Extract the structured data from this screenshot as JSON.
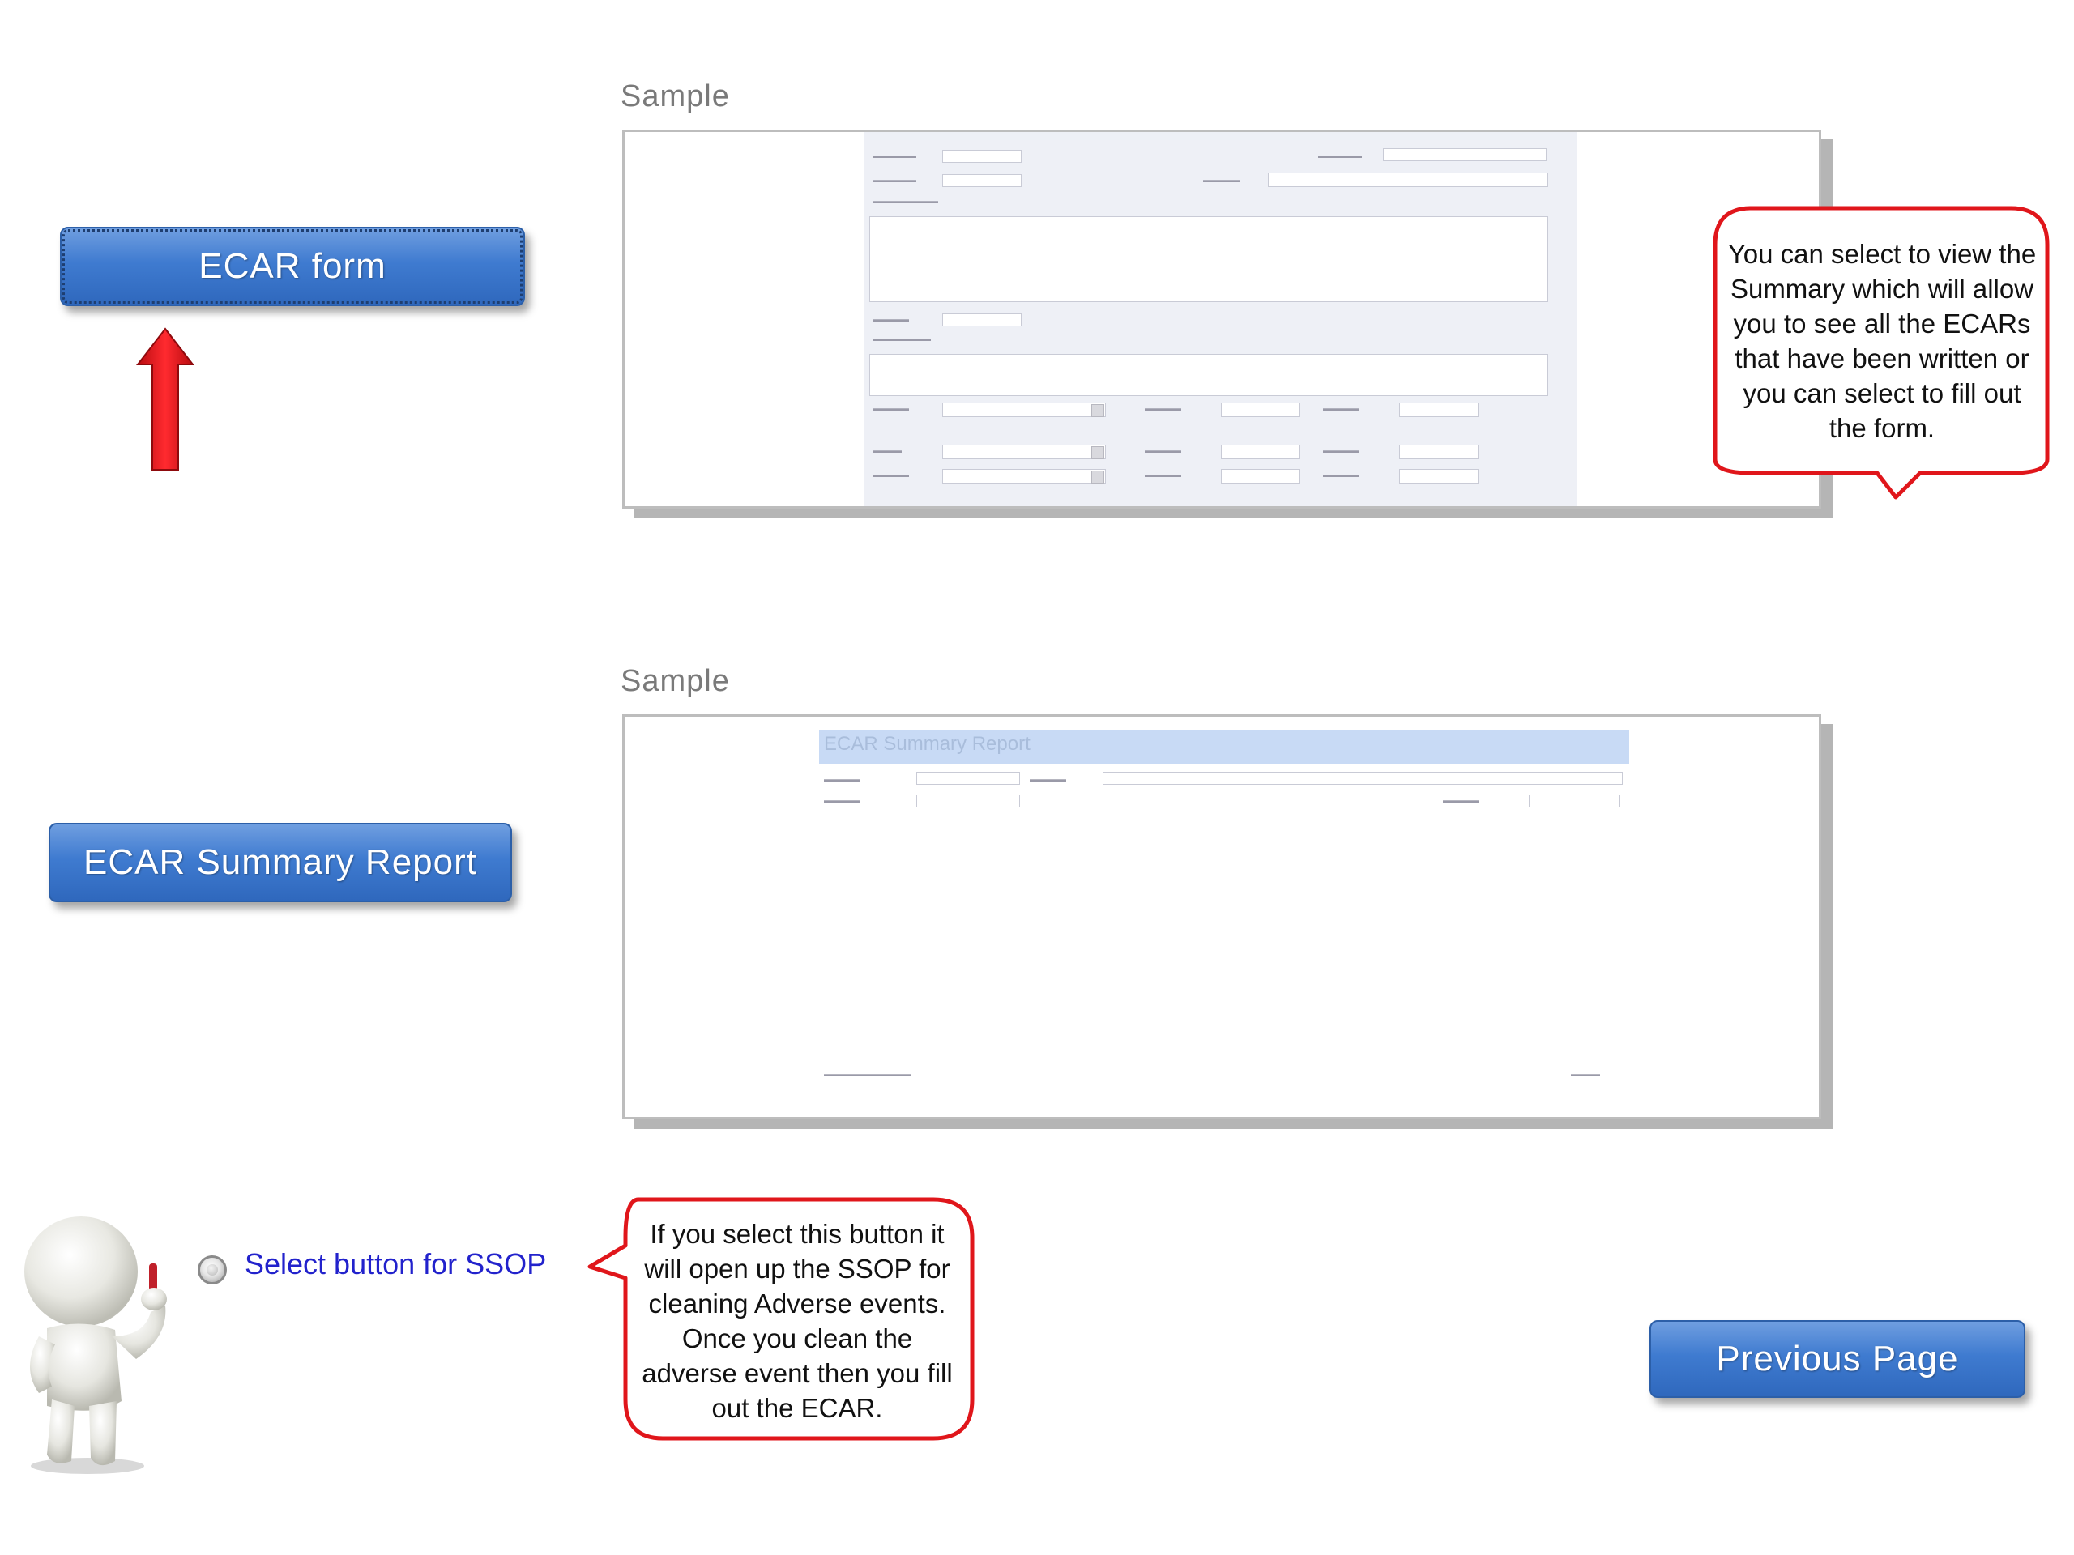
{
  "samples": {
    "top_label": "Sample",
    "bottom_label": "Sample"
  },
  "buttons": {
    "ecar_form": "ECAR form",
    "ecar_summary_report": "ECAR Summary Report",
    "previous_page": "Previous Page"
  },
  "ssop": {
    "label": "Select button for SSOP"
  },
  "callouts": {
    "summary": "You can select to view the Summary which will allow you to see all the ECARs that have been written or you can select to fill out the form.",
    "ssop": "If you select this button it will open up the SSOP for cleaning Adverse events.  Once you clean the adverse event then you fill out the ECAR."
  },
  "report_preview": {
    "title": "ECAR Summary Report"
  },
  "colors": {
    "button_blue": "#3f7bd0",
    "callout_border": "#e0161b",
    "arrow_red": "#e8141a",
    "link_blue": "#2222cc"
  }
}
